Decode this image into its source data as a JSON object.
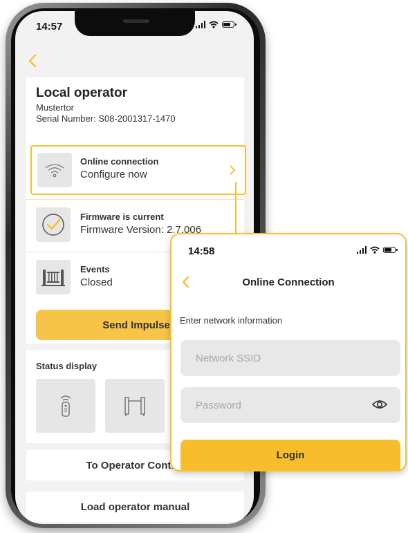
{
  "phone": {
    "status_time": "14:57",
    "operator": {
      "title": "Local operator",
      "name": "Mustertor",
      "serial": "Serial Number: S08-2001317-1470"
    },
    "rows": [
      {
        "title": "Online connection",
        "value": "Configure now",
        "icon": "wifi-icon"
      },
      {
        "title": "Firmware is current",
        "value": "Firmware Version: 2.7.006",
        "icon": "check-circle-icon"
      },
      {
        "title": "Events",
        "value": "Closed",
        "icon": "gate-icon"
      }
    ],
    "impulse_button": "Send Impulse",
    "status_display": {
      "title": "Status display",
      "tiles": [
        "remote-control-icon",
        "gate-posts-icon"
      ]
    },
    "nav": {
      "operator_control": "To Operator Control",
      "manual": "Load operator manual"
    }
  },
  "overlay": {
    "status_time": "14:58",
    "title": "Online Connection",
    "prompt": "Enter network information",
    "ssid_placeholder": "Network SSID",
    "password_placeholder": "Password",
    "login_label": "Login"
  },
  "colors": {
    "accent": "#f7c02f",
    "button": "#f7c447",
    "tile": "#e6e6e6",
    "screen_bg": "#f2f2f2"
  }
}
